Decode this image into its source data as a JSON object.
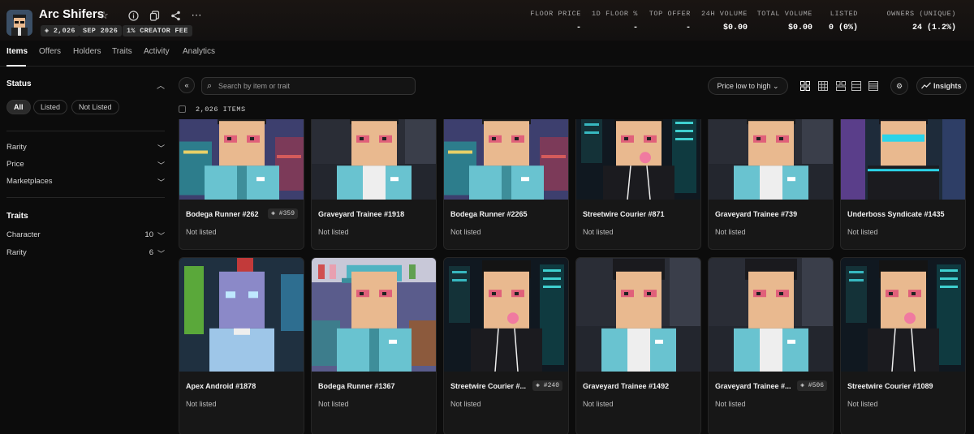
{
  "collection": {
    "title": "Arc Shifers",
    "chips": [
      "2,026",
      "SEP 2026",
      "1% CREATOR FEE"
    ]
  },
  "stats": [
    {
      "label": "FLOOR PRICE",
      "value": "-"
    },
    {
      "label": "1D FLOOR %",
      "value": "-"
    },
    {
      "label": "TOP OFFER",
      "value": "-"
    },
    {
      "label": "24H VOLUME",
      "value": "$0.00"
    },
    {
      "label": "TOTAL VOLUME",
      "value": "$0.00"
    },
    {
      "label": "LISTED",
      "value": "0 (0%)"
    },
    {
      "label": "OWNERS (UNIQUE)",
      "value": "24 (1.2%)"
    }
  ],
  "tabs": [
    "Items",
    "Offers",
    "Holders",
    "Traits",
    "Activity",
    "Analytics"
  ],
  "sidebar": {
    "status_heading": "Status",
    "status_pills": [
      "All",
      "Listed",
      "Not Listed"
    ],
    "filters": [
      "Rarity",
      "Price",
      "Marketplaces"
    ],
    "traits_heading": "Traits",
    "traits": [
      {
        "label": "Character",
        "count": "10"
      },
      {
        "label": "Rarity",
        "count": "6"
      }
    ]
  },
  "toolbar": {
    "search_placeholder": "Search by item or trait",
    "sort_label": "Price low to high",
    "insights_label": "Insights"
  },
  "items_count": "2,026 ITEMS",
  "items": [
    {
      "name": "Bodega Runner #262",
      "status": "Not listed",
      "rank": "#359",
      "character": "bodega"
    },
    {
      "name": "Graveyard Trainee #1918",
      "status": "Not listed",
      "rank": "",
      "character": "graveyard"
    },
    {
      "name": "Bodega Runner #2265",
      "status": "Not listed",
      "rank": "",
      "character": "bodega"
    },
    {
      "name": "Streetwire Courier #871",
      "status": "Not listed",
      "rank": "",
      "character": "courier"
    },
    {
      "name": "Graveyard Trainee #739",
      "status": "Not listed",
      "rank": "",
      "character": "graveyard"
    },
    {
      "name": "Underboss Syndicate #1435",
      "status": "Not listed",
      "rank": "",
      "character": "underboss"
    },
    {
      "name": "Apex Android #1878",
      "status": "Not listed",
      "rank": "",
      "character": "android"
    },
    {
      "name": "Bodega Runner #1367",
      "status": "Not listed",
      "rank": "",
      "character": "bodega-cap"
    },
    {
      "name": "Streetwire Courier #...",
      "status": "Not listed",
      "rank": "#240",
      "character": "courier"
    },
    {
      "name": "Graveyard Trainee #1492",
      "status": "Not listed",
      "rank": "",
      "character": "graveyard-hair"
    },
    {
      "name": "Graveyard Trainee #...",
      "status": "Not listed",
      "rank": "#506",
      "character": "graveyard-hair"
    },
    {
      "name": "Streetwire Courier #1089",
      "status": "Not listed",
      "rank": "",
      "character": "courier"
    }
  ],
  "colors": {
    "background": "#0c0c0c",
    "card": "#171717",
    "skin": "#e9b98f",
    "eye": "#e0607a",
    "teal_jacket": "#69c3d0"
  }
}
